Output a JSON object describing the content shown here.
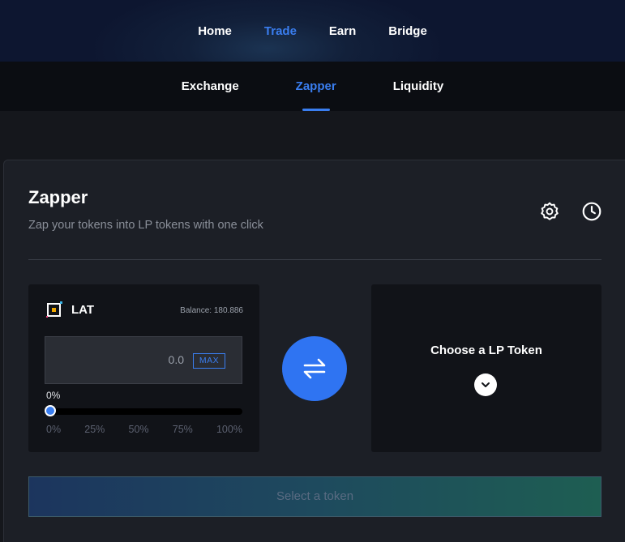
{
  "nav": {
    "items": [
      {
        "label": "Home"
      },
      {
        "label": "Trade"
      },
      {
        "label": "Earn"
      },
      {
        "label": "Bridge"
      }
    ],
    "active": "Trade"
  },
  "subnav": {
    "tabs": [
      {
        "label": "Exchange"
      },
      {
        "label": "Zapper"
      },
      {
        "label": "Liquidity"
      }
    ],
    "active": "Zapper"
  },
  "card": {
    "title": "Zapper",
    "subtitle": "Zap your tokens into LP tokens with one click",
    "icons": [
      "gear-icon",
      "clock-icon"
    ]
  },
  "from": {
    "token": "LAT",
    "balance": "Balance: 180.886",
    "amount": "0.0",
    "max_label": "MAX",
    "percent_label": "0%",
    "percent": 0,
    "ticks": [
      "0%",
      "25%",
      "50%",
      "75%",
      "100%"
    ]
  },
  "to": {
    "label": "Choose a LP Token"
  },
  "action": {
    "button_label": "Select a token"
  },
  "colors": {
    "accent": "#3a7ef0",
    "swap": "#2f74f2",
    "panel": "#111318",
    "card": "#1c1f26"
  }
}
